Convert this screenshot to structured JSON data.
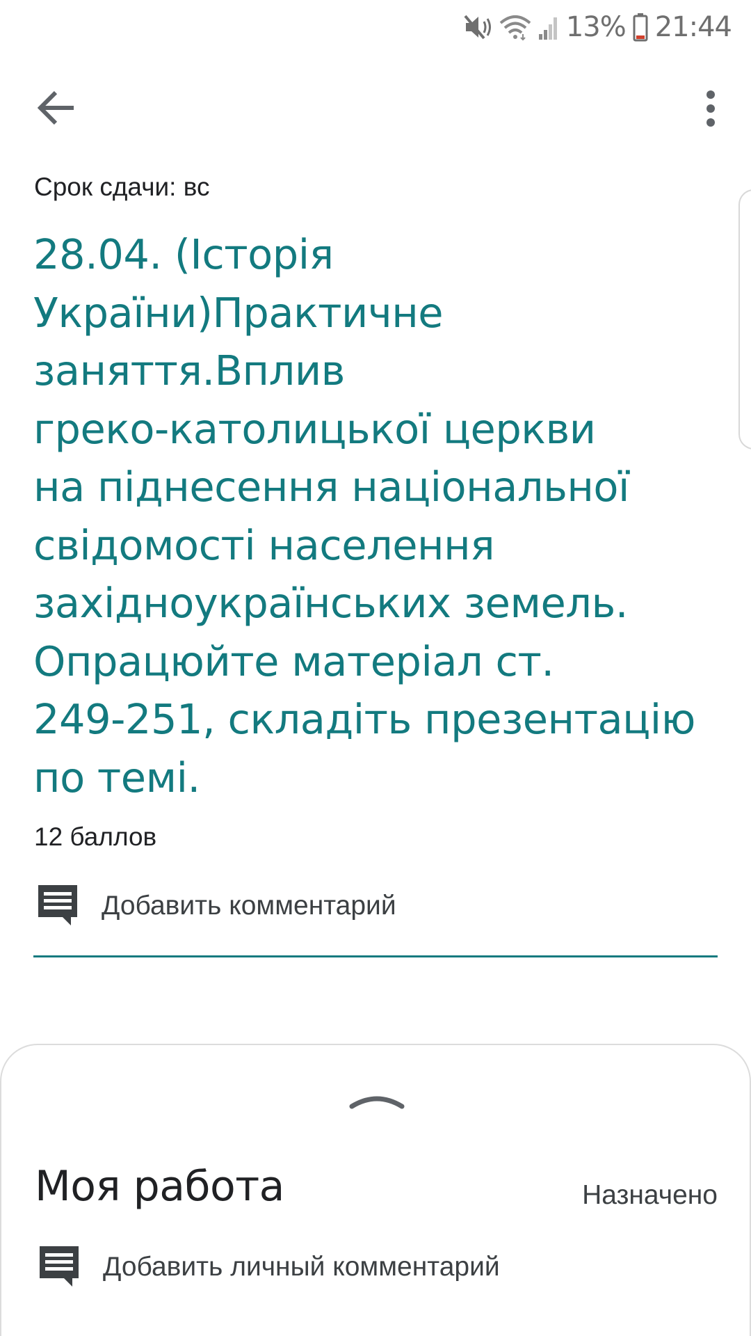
{
  "status_bar": {
    "battery": "13%",
    "time": "21:44",
    "icons": [
      "mute-vibrate-icon",
      "wifi-icon",
      "signal-icon",
      "battery-icon"
    ]
  },
  "app_bar": {
    "back_icon": "arrow-back-icon",
    "more_icon": "more-vert-icon"
  },
  "assignment": {
    "due": "Срок сдачи: вс",
    "title": "28.04. (Історія\nУкраїни)Практичне\nзаняття.Вплив\nгреко-католицької церкви\nна піднесення національної\nсвідомості населення\nзахідноукраїнських земель.\nОпрацюйте матеріал ст.\n249-251, складіть презентацію\nпо темі.",
    "points": "12 баллов",
    "add_comment": "Добавить комментарий"
  },
  "my_work": {
    "title": "Моя работа",
    "status": "Назначено",
    "add_private_comment": "Добавить личный комментарий"
  },
  "colors": {
    "accent": "#137a7f",
    "text_primary": "#202124",
    "text_secondary": "#3c4043",
    "icon_gray": "#5f6368"
  }
}
